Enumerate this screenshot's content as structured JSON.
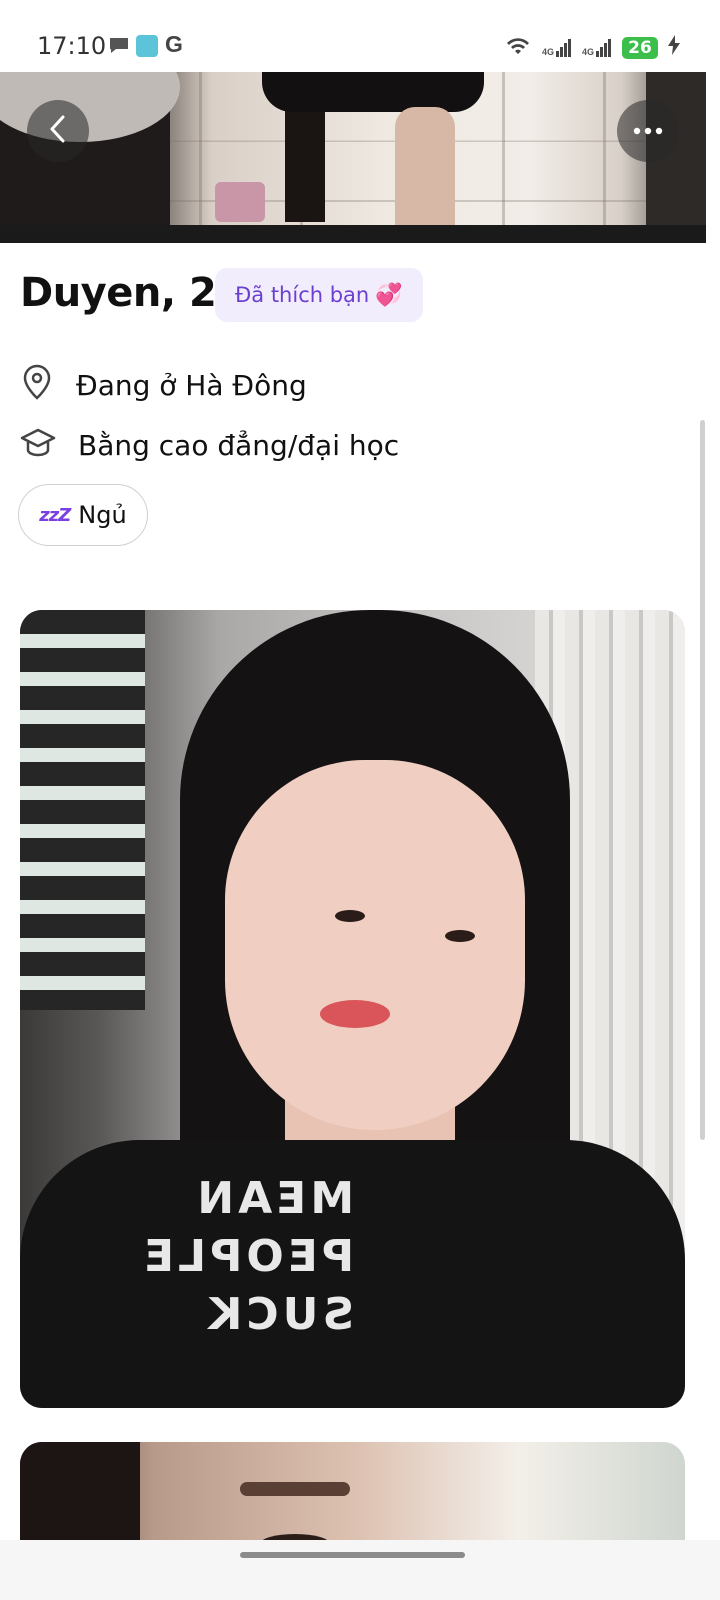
{
  "status_bar": {
    "time": "17:10",
    "network_1": "4G",
    "network_2": "4G",
    "battery": "26"
  },
  "toolbar": {
    "back_icon": "chevron-left-icon",
    "more_icon": "more-horizontal-icon"
  },
  "profile": {
    "name_age": "Duyen, 21",
    "liked_badge": "Đã thích bạn",
    "liked_badge_emoji": "💞",
    "location": "Đang ở Hà Đông",
    "education": "Bằng cao đẳng/đại học",
    "chip_label": "Ngủ",
    "chip_emoji": "zzZ"
  },
  "photo": {
    "shirt_text": [
      "MEAN",
      "PEOPLE",
      "SUCK"
    ]
  },
  "colors": {
    "accent": "#6c3fd0",
    "badge_bg": "#f2edfd",
    "battery": "#3cbf4a"
  }
}
